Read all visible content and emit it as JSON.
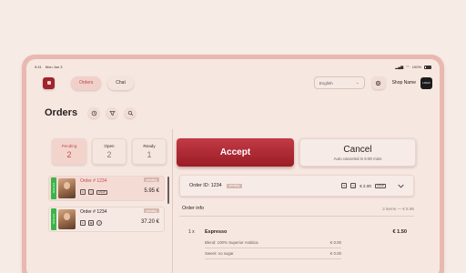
{
  "status_bar": {
    "time": "9:41",
    "date": "Mon Jun 3",
    "battery": "100%"
  },
  "nav": {
    "orders_label": "Orders",
    "chat_label": "Chat"
  },
  "language": {
    "selected": "English"
  },
  "shop": {
    "name": "Shop Name",
    "logo_text": "LOGO"
  },
  "orders": {
    "title": "Orders"
  },
  "tabs": [
    {
      "label": "Pending",
      "count": "2"
    },
    {
      "label": "Open",
      "count": "2"
    },
    {
      "label": "Ready",
      "count": "1"
    }
  ],
  "order_list": [
    {
      "number": "Order # 1234",
      "status": "pending",
      "badge": "ASAP",
      "price": "5.95 €",
      "stripe_label": "Order sent",
      "selected": true
    },
    {
      "number": "Order # 1234",
      "status": "pending",
      "badge": "",
      "price": "37.20 €",
      "stripe_label": "Order sent",
      "selected": false
    }
  ],
  "actions": {
    "accept_label": "Accept",
    "cancel_label": "Cancel",
    "cancel_sub": "Auto canceled in 5:00 mins"
  },
  "order_detail": {
    "id_label": "Order ID: 1234",
    "status": "pending",
    "amount": "€ 2.00",
    "badge": "ASAP"
  },
  "order_info": {
    "title": "Order info",
    "summary": "2 items — € 5.95",
    "items": [
      {
        "qty": "1 x",
        "name": "Espresso",
        "price": "€ 1.50",
        "modifiers": [
          {
            "label": "Blend: 100% Superior Arabica",
            "price": "€ 0.00"
          },
          {
            "label": "Sweet: no sugar",
            "price": "€ 0.00"
          }
        ]
      }
    ]
  },
  "colors": {
    "accent": "#a0242c",
    "active_text": "#c54a55",
    "stripe_green": "#3bb54a",
    "background": "#f6e8e1"
  }
}
